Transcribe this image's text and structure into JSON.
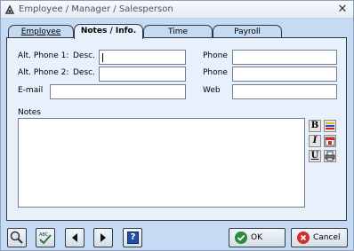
{
  "window": {
    "title": "Employee / Manager / Salesperson",
    "close_label": "✕"
  },
  "tabs": [
    {
      "label": "Employee",
      "active": false
    },
    {
      "label": "Notes / Info.",
      "active": true
    },
    {
      "label": "Time",
      "active": false
    },
    {
      "label": "Payroll",
      "active": false
    }
  ],
  "form": {
    "alt_phone1_label": "Alt. Phone 1:",
    "alt_phone2_label": "Alt. Phone 2:",
    "desc_label": "Desc.",
    "phone_label": "Phone",
    "email_label": "E-mail",
    "web_label": "Web",
    "notes_label": "Notes",
    "alt_phone1_desc": "",
    "alt_phone1": "",
    "alt_phone2_desc": "",
    "alt_phone2": "",
    "email": "",
    "web": "",
    "notes": ""
  },
  "format_toolbar": {
    "bold": "B",
    "italic": "I",
    "underline": "U"
  },
  "buttons": {
    "ok": "OK",
    "cancel": "Cancel",
    "help": "?"
  },
  "colors": {
    "background": "#c5daf3",
    "panel": "#e7f0fb",
    "ok_icon": "#2e8b3d",
    "cancel_icon": "#d22d2d",
    "help_icon": "#1f4fa8"
  }
}
